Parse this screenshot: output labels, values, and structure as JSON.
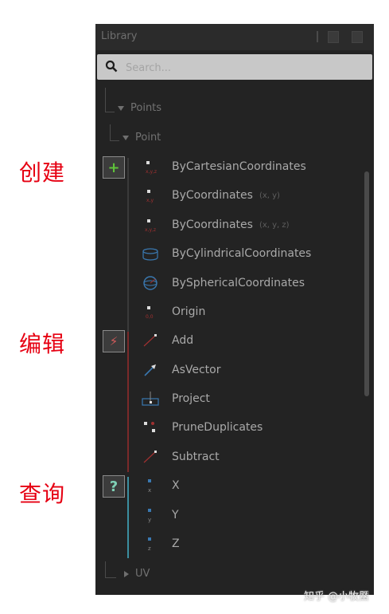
{
  "annotations": {
    "create": "创建",
    "edit": "编辑",
    "query": "查询"
  },
  "window": {
    "title": "Library"
  },
  "search": {
    "placeholder": "Search..."
  },
  "tree": {
    "points": "Points",
    "point": "Point",
    "uv": "UV"
  },
  "buttons": {
    "create": "+",
    "action": "⚡",
    "query": "?"
  },
  "colors": {
    "create": "#5fc23a",
    "action": "#d65a5a",
    "query": "#7fd0b5",
    "annotation": "#e60012"
  },
  "items": [
    {
      "label": "ByCartesianCoordinates",
      "hint": "",
      "icon": "point-xyz-icon"
    },
    {
      "label": "ByCoordinates",
      "hint": "(x, y)",
      "icon": "point-xy-icon"
    },
    {
      "label": "ByCoordinates",
      "hint": "(x, y, z)",
      "icon": "point-xyz-icon"
    },
    {
      "label": "ByCylindricalCoordinates",
      "hint": "",
      "icon": "cylinder-icon"
    },
    {
      "label": "BySphericalCoordinates",
      "hint": "",
      "icon": "sphere-icon"
    },
    {
      "label": "Origin",
      "hint": "",
      "icon": "origin-icon"
    },
    {
      "label": "Add",
      "hint": "",
      "icon": "add-vector-icon"
    },
    {
      "label": "AsVector",
      "hint": "",
      "icon": "vector-arrow-icon"
    },
    {
      "label": "Project",
      "hint": "",
      "icon": "project-plane-icon"
    },
    {
      "label": "PruneDuplicates",
      "hint": "",
      "icon": "prune-points-icon"
    },
    {
      "label": "Subtract",
      "hint": "",
      "icon": "subtract-vector-icon"
    },
    {
      "label": "X",
      "hint": "",
      "icon": "x-component-icon"
    },
    {
      "label": "Y",
      "hint": "",
      "icon": "y-component-icon"
    },
    {
      "label": "Z",
      "hint": "",
      "icon": "z-component-icon"
    }
  ],
  "watermark": "知乎 @小牧鱀"
}
